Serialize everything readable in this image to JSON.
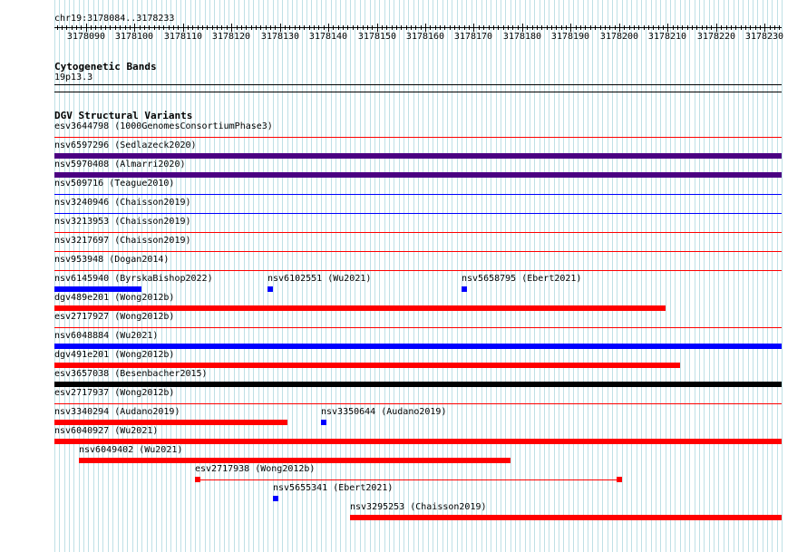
{
  "colors": {
    "grid": "#bfe0e6",
    "red": "#ff0000",
    "blue": "#0000ff",
    "purple": "#4b0082",
    "black": "#000000"
  },
  "ruler": {
    "range_label": "chr19:3178084..3178233",
    "start": 3178084,
    "end": 3178233,
    "tick_labels": [
      "3178090",
      "3178100",
      "3178110",
      "3178120",
      "3178130",
      "3178140",
      "3178150",
      "3178160",
      "3178170",
      "3178180",
      "3178190",
      "3178200",
      "3178210",
      "3178220",
      "3178230"
    ]
  },
  "cytoband": {
    "title": "Cytogenetic Bands",
    "band": "19p13.3"
  },
  "dgv": {
    "title": "DGV Structural Variants",
    "rows": [
      {
        "features": [
          {
            "label": "esv3644798 (1000GenomesConsortiumPhase3)",
            "start": 3178084,
            "end": 3178233,
            "color": "none"
          }
        ],
        "sep": "red"
      },
      {
        "features": [
          {
            "label": "nsv6597296 (Sedlazeck2020)",
            "start": 3178084,
            "end": 3178233,
            "color": "purple"
          }
        ],
        "sep": "none"
      },
      {
        "features": [
          {
            "label": "nsv5970408 (Almarri2020)",
            "start": 3178084,
            "end": 3178233,
            "color": "purple"
          }
        ],
        "sep": "none"
      },
      {
        "features": [
          {
            "label": "nsv509716 (Teague2010)",
            "start": 3178084,
            "end": 3178233,
            "color": "none"
          }
        ],
        "sep": "blue"
      },
      {
        "features": [
          {
            "label": "nsv3240946 (Chaisson2019)",
            "start": 3178084,
            "end": 3178233,
            "color": "none"
          }
        ],
        "sep": "blue"
      },
      {
        "features": [
          {
            "label": "nsv3213953 (Chaisson2019)",
            "start": 3178084,
            "end": 3178233,
            "color": "none"
          }
        ],
        "sep": "red"
      },
      {
        "features": [
          {
            "label": "nsv3217697 (Chaisson2019)",
            "start": 3178084,
            "end": 3178233,
            "color": "none"
          }
        ],
        "sep": "red"
      },
      {
        "features": [
          {
            "label": "nsv953948 (Dogan2014)",
            "start": 3178084,
            "end": 3178233,
            "color": "none"
          }
        ],
        "sep": "red"
      },
      {
        "features": [
          {
            "label": "nsv6145940 (ByrskaBishop2022)",
            "start": 3178084,
            "end": 3178101,
            "color": "blue"
          },
          {
            "label": "nsv6102551 (Wu2021)",
            "start": 3178128,
            "end": 3178129,
            "color": "blue"
          },
          {
            "label": "nsv5658795 (Ebert2021)",
            "start": 3178168,
            "end": 3178169,
            "color": "blue"
          }
        ],
        "sep": "none"
      },
      {
        "features": [
          {
            "label": "dgv489e201 (Wong2012b)",
            "start": 3178084,
            "end": 3178209,
            "color": "red"
          }
        ],
        "sep": "none"
      },
      {
        "features": [
          {
            "label": "esv2717927 (Wong2012b)",
            "start": 3178084,
            "end": 3178233,
            "color": "none"
          }
        ],
        "sep": "red"
      },
      {
        "features": [
          {
            "label": "nsv6048884 (Wu2021)",
            "start": 3178084,
            "end": 3178233,
            "color": "blue"
          }
        ],
        "sep": "none"
      },
      {
        "features": [
          {
            "label": "dgv491e201 (Wong2012b)",
            "start": 3178084,
            "end": 3178212,
            "color": "red"
          }
        ],
        "sep": "none"
      },
      {
        "features": [
          {
            "label": "esv3657038 (Besenbacher2015)",
            "start": 3178084,
            "end": 3178233,
            "color": "black"
          }
        ],
        "sep": "none"
      },
      {
        "features": [
          {
            "label": "esv2717937 (Wong2012b)",
            "start": 3178084,
            "end": 3178233,
            "color": "none"
          }
        ],
        "sep": "red"
      },
      {
        "features": [
          {
            "label": "nsv3340294 (Audano2019)",
            "start": 3178084,
            "end": 3178131,
            "color": "red"
          },
          {
            "label": "nsv3350644 (Audano2019)",
            "start": 3178139,
            "end": 3178140,
            "color": "blue"
          }
        ],
        "sep": "none"
      },
      {
        "features": [
          {
            "label": "nsv6040927 (Wu2021)",
            "start": 3178084,
            "end": 3178233,
            "color": "red"
          }
        ],
        "sep": "none"
      },
      {
        "features": [
          {
            "label": "nsv6049402 (Wu2021)",
            "start": 3178089,
            "end": 3178177,
            "color": "red"
          }
        ],
        "sep": "none"
      },
      {
        "features": [
          {
            "label": "esv2717938 (Wong2012b)",
            "start": 3178113,
            "end": 3178200,
            "color": "red-ends"
          }
        ],
        "sep": "none"
      },
      {
        "features": [
          {
            "label": "nsv5655341 (Ebert2021)",
            "start": 3178129,
            "end": 3178130,
            "color": "blue"
          }
        ],
        "sep": "none"
      },
      {
        "features": [
          {
            "label": "nsv3295253 (Chaisson2019)",
            "start": 3178145,
            "end": 3178233,
            "color": "red"
          }
        ],
        "sep": "none"
      }
    ]
  }
}
